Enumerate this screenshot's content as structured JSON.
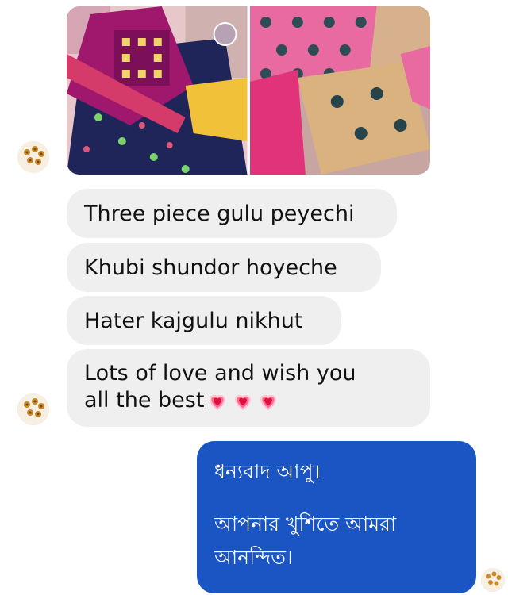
{
  "thread": {
    "shared_photos": [
      {
        "alt_icon": "embroidered-dress-photo-1"
      },
      {
        "alt_icon": "embroidered-dress-photo-2"
      }
    ],
    "incoming_messages": [
      {
        "text": "Three piece gulu peyechi"
      },
      {
        "text": "Khubi shundor hoyeche"
      },
      {
        "text": "Hater kajgulu nikhut"
      },
      {
        "text_line1": "Lots of love and wish you",
        "text_line2": "all the best",
        "emoji": "heart-emoji",
        "emoji_count": 3
      }
    ],
    "outgoing_message": {
      "line1": "ধন্যবাদ আপু।",
      "line2": "আপনার খুশিতে আমরা",
      "line3": "আনন্দিত।",
      "bg_color": "#1b55c4"
    }
  },
  "colors": {
    "incoming_bubble": "#efefef",
    "outgoing_bubble": "#1b55c4"
  }
}
